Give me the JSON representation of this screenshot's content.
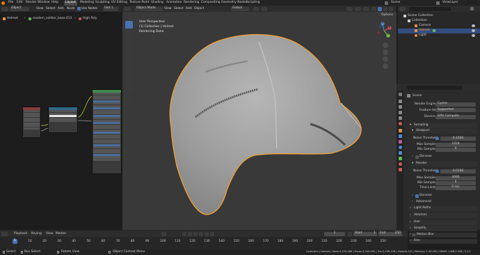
{
  "topbar": {
    "menus": [
      "File",
      "Edit",
      "Render",
      "Window",
      "Help"
    ],
    "workspaces": [
      "Layout",
      "Modeling",
      "Sculpting",
      "UV Editing",
      "Texture Paint",
      "Shading",
      "Animation",
      "Rendering",
      "Compositing",
      "Geometry Nodes",
      "Scripting"
    ],
    "scene": "Scene",
    "view_layer": "ViewLayer"
  },
  "node_editor": {
    "mode": "Object",
    "menus": [
      "View",
      "Select",
      "Add",
      "Node"
    ],
    "use_nodes": "Use Nodes",
    "slot": "Slot 1",
    "breadcrumb": [
      "Helmet",
      "modern_soldier_base.013",
      "High Poly"
    ]
  },
  "viewport": {
    "mode": "Object Mode",
    "menus": [
      "View",
      "Select",
      "Add",
      "Object"
    ],
    "transform": "Global",
    "overlay_lines": [
      "User Perspective",
      "(1) Collection | Helmet",
      "Rendering Done"
    ],
    "options": "Options",
    "gizmo": {
      "z": "Z",
      "y": "Y",
      "x": "X"
    },
    "colors": {
      "mesh": "#9c9c9c",
      "outline": "#f0a030"
    }
  },
  "outliner": {
    "items": [
      {
        "label": "Scene Collection",
        "selected": false
      },
      {
        "label": "Collection",
        "selected": false
      },
      {
        "label": "Camera",
        "selected": false
      },
      {
        "label": "Helmet",
        "selected": true
      },
      {
        "label": "Light",
        "selected": false
      }
    ]
  },
  "properties": {
    "scene": "Scene",
    "render_engine_label": "Render Engine",
    "render_engine": "Cycles",
    "feature_set_label": "Feature Set",
    "feature_set": "Supported",
    "device_label": "Device",
    "device": "GPU Compute",
    "sampling": "Sampling",
    "viewport": "Viewport",
    "noise_threshold_label": "Noise Threshold",
    "vp_noise_threshold": "0.1000",
    "max_samples_label": "Max Samples",
    "vp_max_samples": "1024",
    "min_samples_label": "Min Samples",
    "vp_min_samples": "0",
    "denoise": "Denoise",
    "render": "Render",
    "r_noise_threshold": "0.0100",
    "r_max_samples": "4096",
    "r_min_samples": "0",
    "time_limit_label": "Time Limit",
    "r_time_limit": "0 sec",
    "advanced": "Advanced",
    "sections": [
      "Light Paths",
      "Volumes",
      "Hair",
      "Simplify",
      "Motion Blur",
      "Film"
    ]
  },
  "timeline": {
    "menus": [
      "Playback",
      "Keying",
      "View",
      "Marker"
    ],
    "current_frame": "1",
    "start_label": "Start",
    "start": "1",
    "end_label": "End",
    "end": "250",
    "ticks": [
      "0",
      "10",
      "20",
      "30",
      "40",
      "50",
      "60",
      "70",
      "80",
      "90",
      "100",
      "110",
      "120",
      "130",
      "140",
      "150",
      "160",
      "170",
      "180",
      "190",
      "200",
      "210",
      "220",
      "230",
      "240",
      "250"
    ]
  },
  "statusbar": {
    "select": "Select",
    "box_select": "Box Select",
    "rotate_view": "Rotate View",
    "context_menu": "Object Context Menu",
    "stats": "Collection | Helmet | Verts:3,229,066 | Faces:3,349,992 | Tris:2,458,128 | Objects:1/3 | Memory: 1.49 GiB | VRAM: 1.6/8.0 GiB | 3.2.0"
  }
}
